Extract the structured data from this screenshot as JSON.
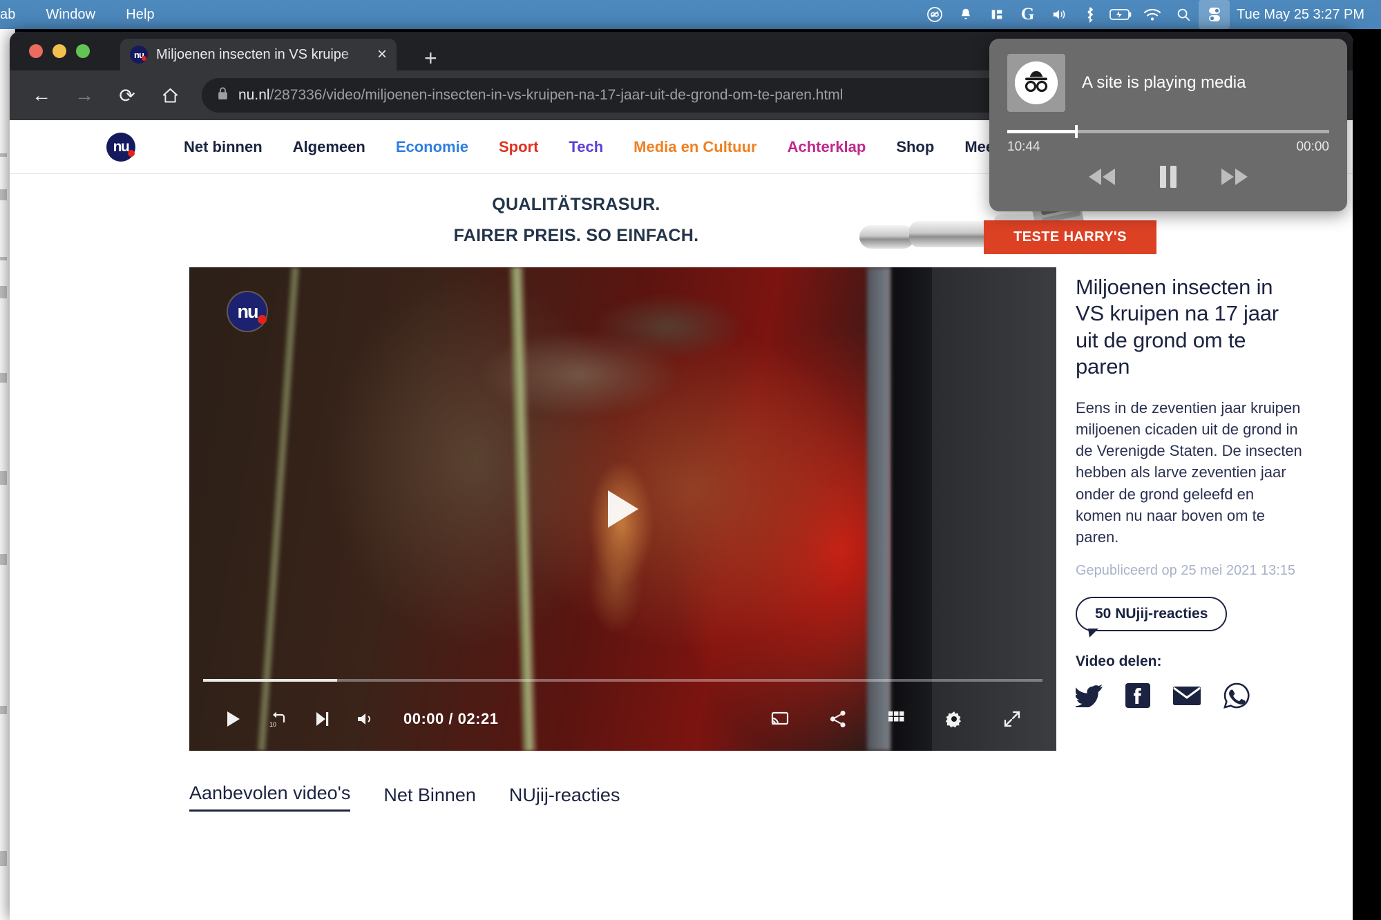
{
  "menubar": {
    "left_items": [
      "ab",
      "Window",
      "Help"
    ],
    "right_icons": [
      "symbol-icon",
      "bell-icon",
      "columns-icon",
      "google-icon",
      "volume-icon",
      "bluetooth-icon",
      "battery-icon",
      "wifi-icon",
      "search-icon",
      "control-center-icon"
    ],
    "clock": "Tue May 25  3:27 PM"
  },
  "browser": {
    "tab": {
      "title": "Miljoenen insecten in VS kruipe",
      "favicon_text": "nu",
      "close_label": "×",
      "newtab_label": "+"
    },
    "toolbar": {
      "back_label": "←",
      "forward_label": "→",
      "reload_label": "⟳",
      "home_label": "⌂",
      "url_domain": "nu.nl",
      "url_path": "/287336/video/miljoenen-insecten-in-vs-kruipen-na-17-jaar-uit-de-grond-om-te-paren.html"
    }
  },
  "media_popup": {
    "title": "A site is playing media",
    "thumb_icon": "incognito-icon",
    "elapsed": "10:44",
    "remaining": "00:00",
    "progress_percent": 21,
    "rewind_label": "rewind-icon",
    "pause_label": "pause-icon",
    "forward_label": "forward-icon"
  },
  "site_nav": {
    "logo_text": "nu",
    "items": [
      {
        "label": "Net binnen",
        "color": "#1b2340"
      },
      {
        "label": "Algemeen",
        "color": "#1b2340"
      },
      {
        "label": "Economie",
        "color": "#2e7fe0"
      },
      {
        "label": "Sport",
        "color": "#e23020"
      },
      {
        "label": "Tech",
        "color": "#5d3fd3"
      },
      {
        "label": "Media en Cultuur",
        "color": "#f08020"
      },
      {
        "label": "Achterklap",
        "color": "#c0288c"
      },
      {
        "label": "Shop",
        "color": "#1b2340"
      },
      {
        "label": "Meer",
        "color": "#1b2340"
      }
    ]
  },
  "ad": {
    "line1": "QUALITÄTSRASUR.",
    "line2": "FAIRER PREIS. SO EINFACH.",
    "brand": "HARRY'S",
    "cta": "TESTE HARRY'S",
    "adchoices_label": "▷",
    "close_label": "✕",
    "product_icon": "razor-icon"
  },
  "video": {
    "watermark_text": "nu",
    "play_label": "play-icon",
    "progress_percent": 16,
    "controls_left": [
      "play-icon",
      "rewind-10-icon",
      "next-icon",
      "volume-icon"
    ],
    "time_current": "00:00",
    "time_separator": "/",
    "time_total": "02:21",
    "controls_right": [
      "cast-icon",
      "share-icon",
      "playlist-grid-icon",
      "settings-gear-icon",
      "fullscreen-icon"
    ]
  },
  "article": {
    "title": "Miljoenen insecten in VS kruipen na 17 jaar uit de grond om te paren",
    "lead": "Eens in de zeventien jaar kruipen miljoenen cicaden uit de grond in de Verenigde Staten. De insecten hebben als larve zeventien jaar onder de grond geleefd en komen nu naar boven om te paren.",
    "published": "Gepubliceerd op 25 mei 2021 13:15",
    "reactions": "50 NUjij-reacties",
    "share_label": "Video delen:",
    "share_icons": [
      "twitter-icon",
      "facebook-icon",
      "email-icon",
      "whatsapp-icon"
    ]
  },
  "bottom_tabs": [
    {
      "label": "Aanbevolen video's",
      "active": true
    },
    {
      "label": "Net Binnen",
      "active": false
    },
    {
      "label": "NUjij-reacties",
      "active": false
    }
  ]
}
